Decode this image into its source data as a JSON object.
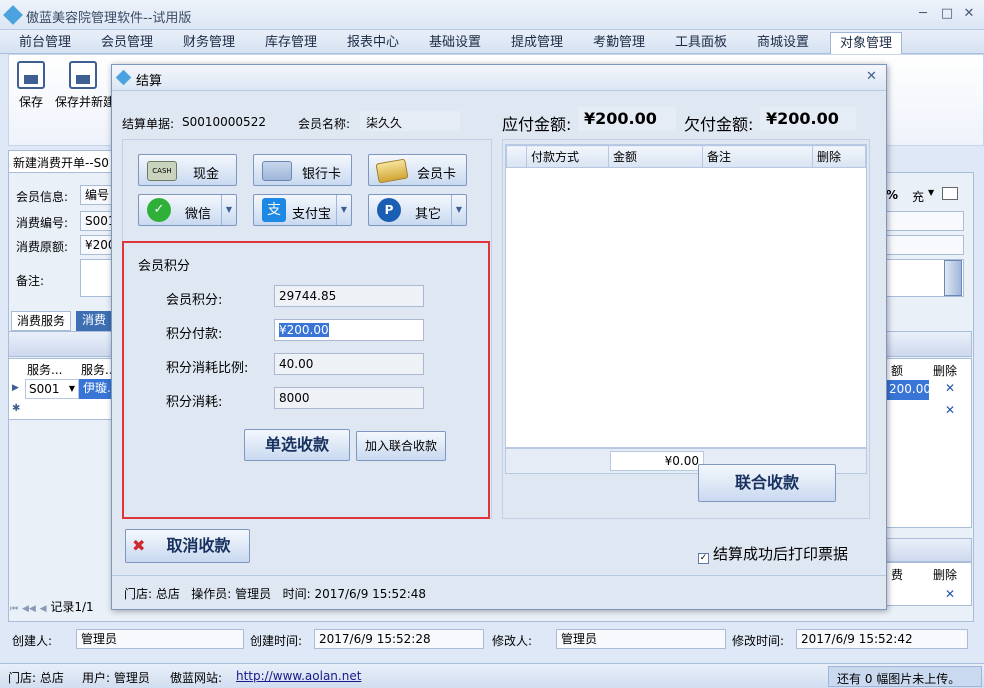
{
  "app": {
    "title": "傲蓝美容院管理软件--试用版"
  },
  "menu": {
    "tabs": [
      "前台管理",
      "会员管理",
      "财务管理",
      "库存管理",
      "报表中心",
      "基础设置",
      "提成管理",
      "考勤管理",
      "工具面板",
      "商城设置",
      "对象管理"
    ],
    "active": "对象管理"
  },
  "ribbon": {
    "save": "保存",
    "save_new": "保存并新建"
  },
  "bg": {
    "doc_tab": "新建消费开单--S0",
    "member_info_label": "会员信息:",
    "member_info_value": "编号",
    "consume_no_label": "消费编号:",
    "consume_no_value": "S001",
    "orig_amount_label": "消费原额:",
    "orig_amount_value": "¥200",
    "remark_label": "备注:",
    "right_pct": "%",
    "right_charge": "充",
    "tabs": [
      "消费服务",
      "消费产"
    ],
    "grid_headers": [
      "服务...",
      "服务..."
    ],
    "grid_row": {
      "code": "S001",
      "name": "伊璇..."
    },
    "right_col_header": "额",
    "right_del_header": "删除",
    "right_amount": "200.00",
    "right_col_header2": "费",
    "right_del_header2": "删除",
    "record": "记录1/1",
    "creator_label": "创建人:",
    "creator_value": "管理员",
    "created_label": "创建时间:",
    "created_value": "2017/6/9 15:52:28",
    "modifier_label": "修改人:",
    "modifier_value": "管理员",
    "modified_label": "修改时间:",
    "modified_value": "2017/6/9 15:52:42"
  },
  "dialog": {
    "title": "结算",
    "bill_label": "结算单据:",
    "bill_value": "S0010000522",
    "member_label": "会员名称:",
    "member_value": "柒久久",
    "due_label": "应付金额:",
    "due_value": "¥200.00",
    "owe_label": "欠付金额:",
    "owe_value": "¥200.00",
    "pay_buttons": [
      "现金",
      "银行卡",
      "会员卡",
      "微信",
      "支付宝",
      "其它"
    ],
    "points": {
      "section": "会员积分",
      "points_label": "会员积分:",
      "points_value": "29744.85",
      "pay_label": "积分付款:",
      "pay_value": "¥200.00",
      "ratio_label": "积分消耗比例:",
      "ratio_value": "40.00",
      "cost_label": "积分消耗:",
      "cost_value": "8000",
      "single_btn": "单选收款",
      "join_btn": "加入联合收款"
    },
    "grid_headers": [
      "付款方式",
      "金额",
      "备注",
      "删除"
    ],
    "grid_total": "¥0.00",
    "combined_btn": "联合收款",
    "cancel_btn": "取消收款",
    "print_label": "结算成功后打印票据",
    "footer": "门店: 总店   操作员: 管理员   时间: 2017/6/9 15:52:48"
  },
  "status": {
    "store": "门店: 总店",
    "user": "用户: 管理员",
    "site_label": "傲蓝网站:",
    "site_url": "http://www.aolan.net",
    "right": "还有 0 幅图片未上传。"
  },
  "colors": {
    "accent": "#3e5f92",
    "highlight_border": "#e0343a",
    "selection": "#3875d7"
  }
}
